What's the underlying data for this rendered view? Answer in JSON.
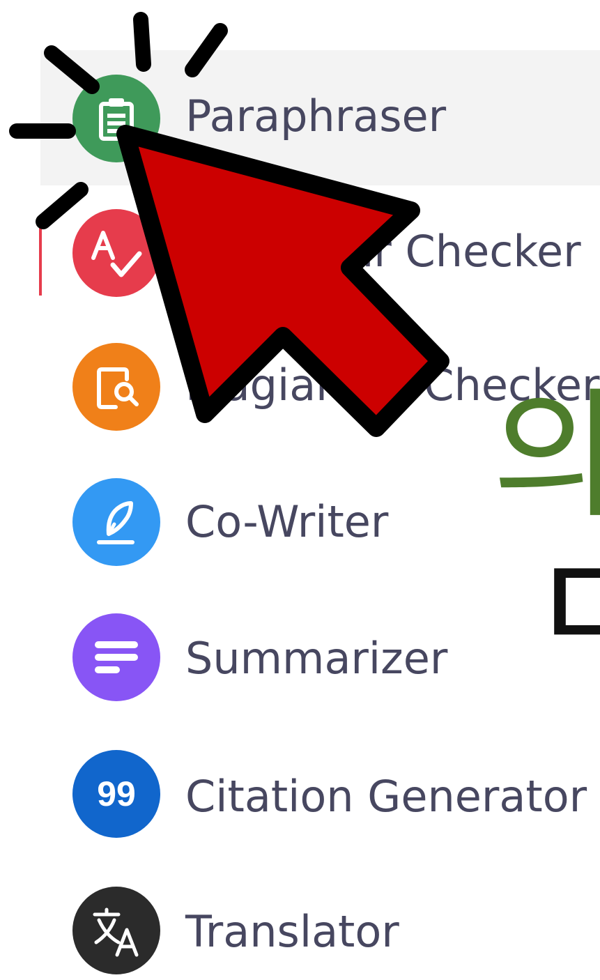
{
  "menu": {
    "items": [
      {
        "label": "Paraphraser",
        "icon": "paraphraser-icon",
        "color": "#3f9a5a",
        "active": true
      },
      {
        "label": "Grammar Checker",
        "icon": "grammar-check-icon",
        "color": "#e63c4c",
        "active": false
      },
      {
        "label": "Plagiarism Checker",
        "icon": "plagiarism-search-icon",
        "color": "#f08019",
        "active": false
      },
      {
        "label": "Co-Writer",
        "icon": "quill-pen-icon",
        "color": "#3399f3",
        "active": false
      },
      {
        "label": "Summarizer",
        "icon": "summary-lines-icon",
        "color": "#8855f5",
        "active": false
      },
      {
        "label": "Citation Generator",
        "icon": "quote-icon",
        "color": "#1166cc",
        "active": false
      },
      {
        "label": "Translator",
        "icon": "translate-icon",
        "color": "#2b2b2b",
        "active": false
      }
    ]
  },
  "overlay": {
    "korean_text_1": "의",
    "korean_text_2": "ㄷ",
    "korean_text_1_color": "#4e7d2c",
    "arrow_color": "#cc0000",
    "arrow_outline_color": "#000000",
    "cursor_icon": "red-arrow-pointer-icon"
  },
  "theme": {
    "label_color": "#474760",
    "active_background": "#f3f3f3"
  }
}
